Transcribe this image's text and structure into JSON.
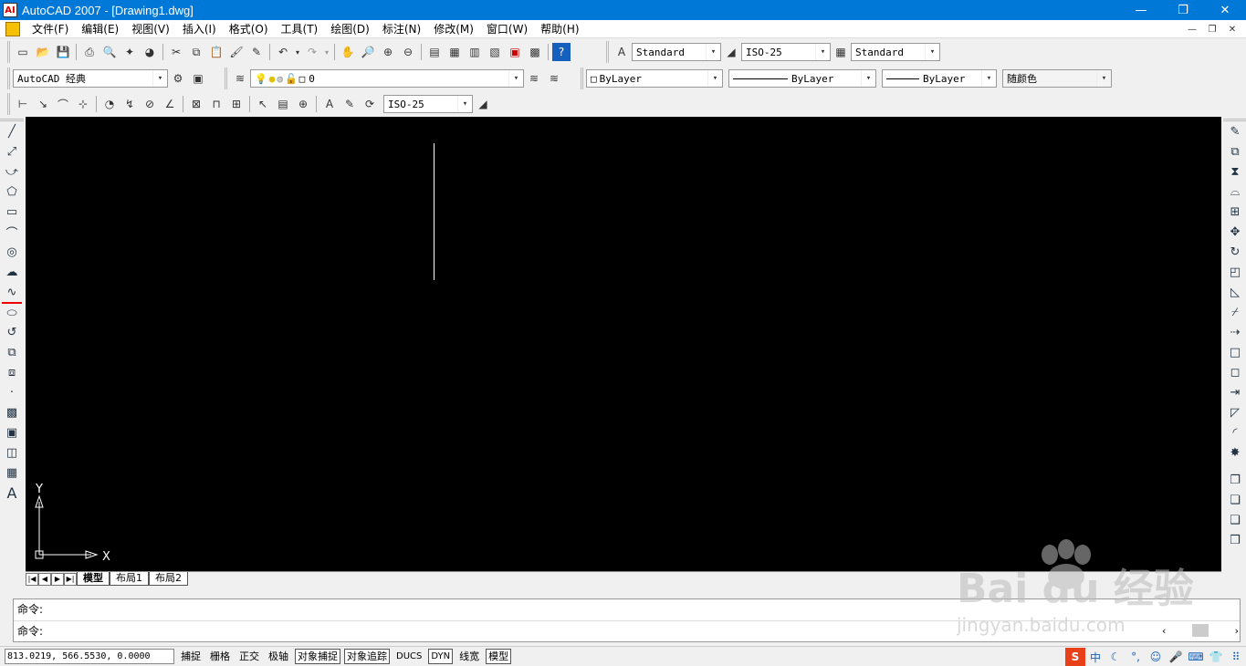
{
  "window": {
    "title": "AutoCAD 2007 - [Drawing1.dwg]",
    "app_icon": "AI"
  },
  "menu": [
    "文件(F)",
    "编辑(E)",
    "视图(V)",
    "插入(I)",
    "格式(O)",
    "工具(T)",
    "绘图(D)",
    "标注(N)",
    "修改(M)",
    "窗口(W)",
    "帮助(H)"
  ],
  "toolbar1": {
    "text_style": "Standard",
    "dim_style": "ISO-25",
    "table_style": "Standard"
  },
  "toolbar2": {
    "workspace": "AutoCAD 经典",
    "layer": "0",
    "color": "ByLayer",
    "linetype": "ByLayer",
    "lineweight": "ByLayer",
    "plotstyle": "随颜色"
  },
  "toolbar3": {
    "dim_style": "ISO-25"
  },
  "ucs": {
    "x_label": "X",
    "y_label": "Y"
  },
  "tabs": [
    "模型",
    "布局1",
    "布局2"
  ],
  "command": {
    "line1": "命令:",
    "line2": "命令:"
  },
  "status": {
    "coords": "813.0219, 566.5530, 0.0000",
    "buttons": [
      {
        "label": "捕捉",
        "on": false
      },
      {
        "label": "栅格",
        "on": false
      },
      {
        "label": "正交",
        "on": false
      },
      {
        "label": "极轴",
        "on": false
      },
      {
        "label": "对象捕捉",
        "on": true
      },
      {
        "label": "对象追踪",
        "on": true
      },
      {
        "label": "DUCS",
        "on": false
      },
      {
        "label": "DYN",
        "on": true
      },
      {
        "label": "线宽",
        "on": false
      },
      {
        "label": "模型",
        "on": true
      }
    ]
  },
  "watermark": {
    "text": "Bai du 经验",
    "url": "jingyan.baidu.com"
  },
  "colors": {
    "titlebar": "#0078d7",
    "canvas": "#000000"
  }
}
